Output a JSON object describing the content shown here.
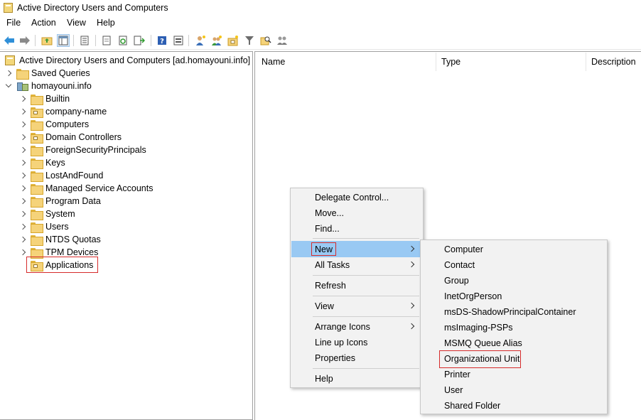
{
  "window": {
    "title": "Active Directory Users and Computers"
  },
  "menu": [
    "File",
    "Action",
    "View",
    "Help"
  ],
  "toolbar_icons": [
    "back-icon",
    "forward-icon",
    "up-folder-icon",
    "show-tree-icon",
    "properties-icon",
    "export-list-icon",
    "refresh-icon",
    "export-icon",
    "help-icon",
    "console-icon",
    "new-user-icon",
    "new-group-icon",
    "new-ou-icon",
    "filter-icon",
    "find-icon",
    "delegate-icon"
  ],
  "tree": {
    "root": "Active Directory Users and Computers [ad.homayouni.info]",
    "saved_queries": "Saved Queries",
    "domain": "homayouni.info",
    "children": [
      "Builtin",
      "company-name",
      "Computers",
      "Domain Controllers",
      "ForeignSecurityPrincipals",
      "Keys",
      "LostAndFound",
      "Managed Service Accounts",
      "Program Data",
      "System",
      "Users",
      "NTDS Quotas",
      "TPM Devices",
      "Applications"
    ]
  },
  "list": {
    "columns": [
      "Name",
      "Type",
      "Description"
    ]
  },
  "context_menu": {
    "items": [
      "Delegate Control...",
      "Move...",
      "Find...",
      "New",
      "All Tasks",
      "Refresh",
      "View",
      "Arrange Icons",
      "Line up Icons",
      "Properties",
      "Help"
    ]
  },
  "submenu": {
    "items": [
      "Computer",
      "Contact",
      "Group",
      "InetOrgPerson",
      "msDS-ShadowPrincipalContainer",
      "msImaging-PSPs",
      "MSMQ Queue Alias",
      "Organizational Unit",
      "Printer",
      "User",
      "Shared Folder"
    ]
  },
  "colors": {
    "highlight": "#99c9f3",
    "annotation": "#d62b2b",
    "folder": "#f5d37a"
  }
}
